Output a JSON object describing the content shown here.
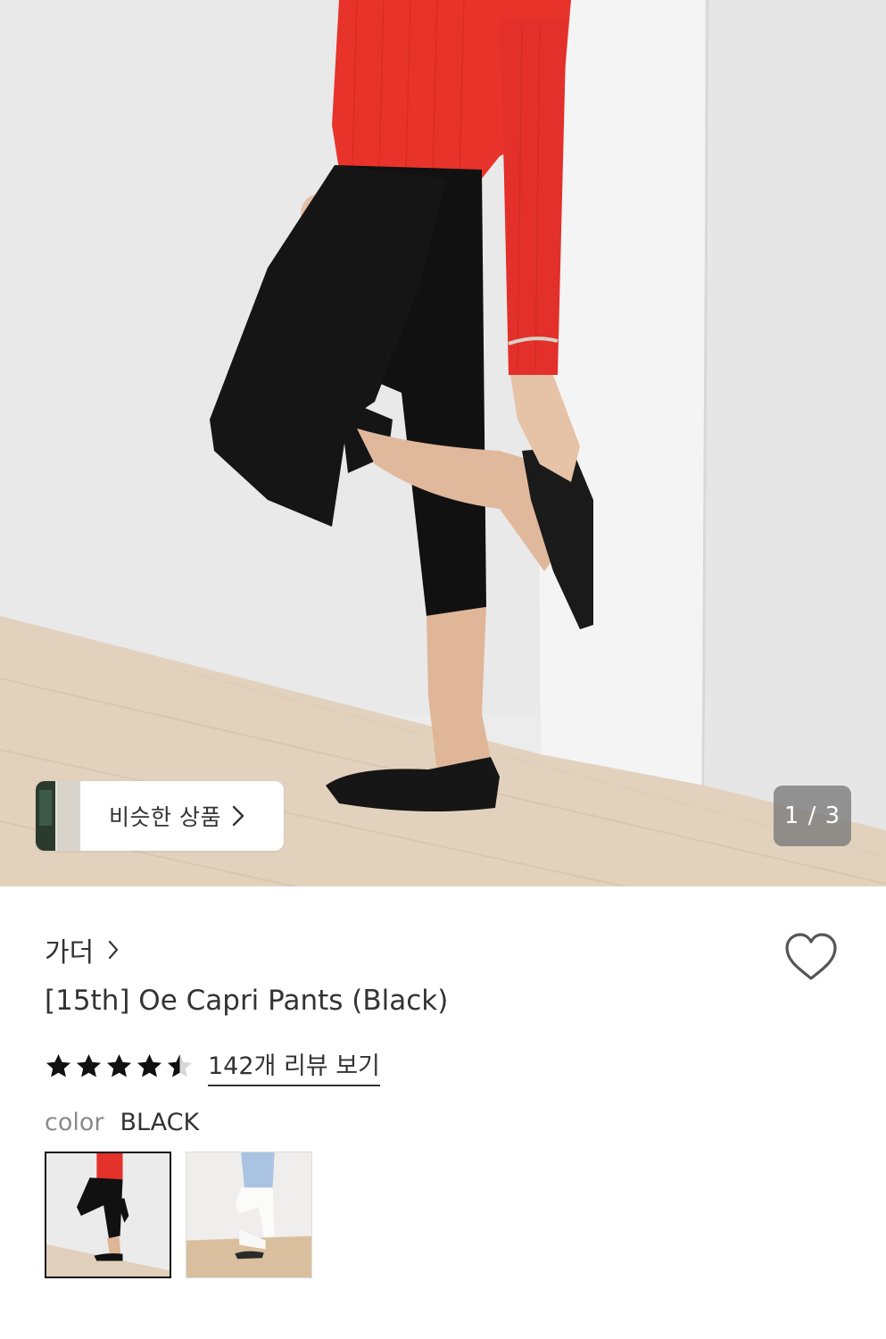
{
  "hero": {
    "similar_products_label": "비슷한 상품",
    "page_counter": "1 / 3"
  },
  "product": {
    "brand": "가더",
    "title": "[15th] Oe Capri Pants (Black)",
    "rating": 4.5,
    "stars_max": 5,
    "review_link": "142개 리뷰 보기",
    "color_label": "color",
    "color_value": "BLACK",
    "swatches": [
      {
        "name": "black",
        "selected": true
      },
      {
        "name": "white",
        "selected": false
      }
    ]
  },
  "icons": {
    "similar_chevron": "chevron-right-icon",
    "brand_chevron": "chevron-right-icon",
    "wishlist": "heart-outline-icon",
    "star": "star-icon"
  },
  "colors": {
    "text_primary": "#333333",
    "text_muted": "#8a8a8a",
    "counter_bg": "#787878",
    "selected_border": "#111111"
  }
}
